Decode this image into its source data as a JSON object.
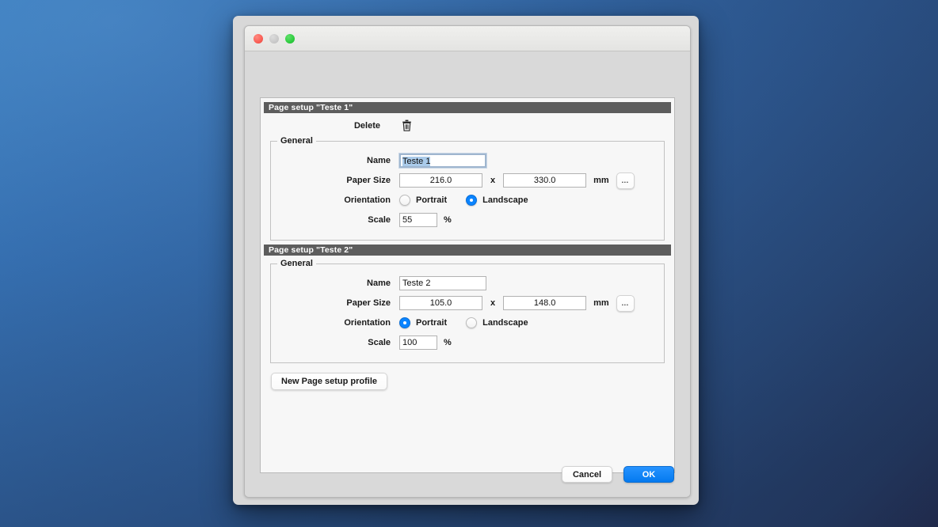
{
  "window": {
    "traffic_lights": [
      "close",
      "minimize",
      "zoom"
    ],
    "colors": {
      "close": "#fa5e55",
      "minimize": "#c9c9c9",
      "zoom": "#2ecc3f",
      "accent": "#0a84ff",
      "section_header_bg": "#5d5d5d",
      "selection": "#aacbea"
    }
  },
  "sections": [
    {
      "header": "Page setup \"Teste 1\"",
      "delete_label": "Delete",
      "delete_icon": "trash-icon",
      "legend": "General",
      "name_label": "Name",
      "name_value": "Teste 1",
      "name_focused": true,
      "paper_size_label": "Paper Size",
      "paper_width": "216.0",
      "paper_x": "x",
      "paper_height": "330.0",
      "unit": "mm",
      "more_button": "...",
      "orientation_label": "Orientation",
      "orientation_options": [
        "Portrait",
        "Landscape"
      ],
      "orientation_selected": "Landscape",
      "scale_label": "Scale",
      "scale_value": "55",
      "scale_unit": "%"
    },
    {
      "header": "Page setup \"Teste 2\"",
      "legend": "General",
      "name_label": "Name",
      "name_value": "Teste 2",
      "name_focused": false,
      "paper_size_label": "Paper Size",
      "paper_width": "105.0",
      "paper_x": "x",
      "paper_height": "148.0",
      "unit": "mm",
      "more_button": "...",
      "orientation_label": "Orientation",
      "orientation_options": [
        "Portrait",
        "Landscape"
      ],
      "orientation_selected": "Portrait",
      "scale_label": "Scale",
      "scale_value": "100",
      "scale_unit": "%"
    }
  ],
  "new_profile_button": "New Page setup profile",
  "footer": {
    "cancel_label": "Cancel",
    "ok_label": "OK"
  }
}
